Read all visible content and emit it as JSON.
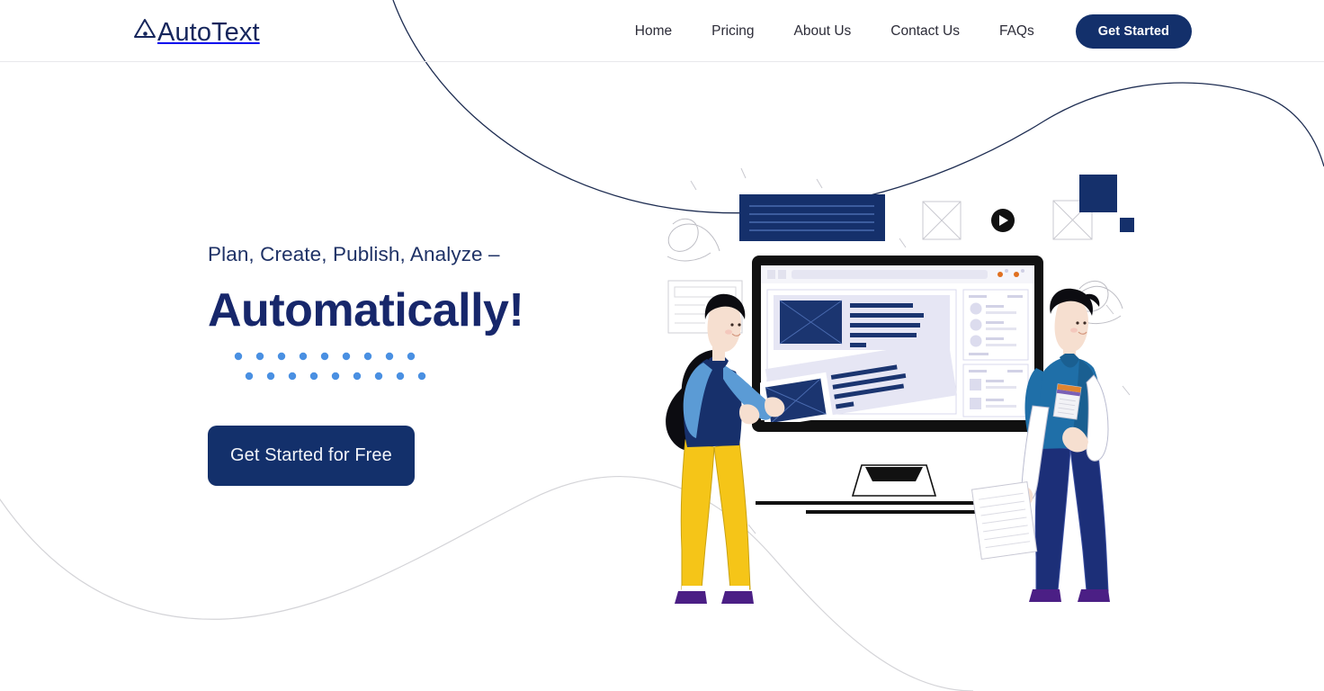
{
  "brand": {
    "name": "AutoText",
    "logo_icon": "triangle-a-logo-icon",
    "navy": "#13306b",
    "accent_blue": "#4a90e2",
    "yellow": "#f5c518",
    "teal": "#1f6fa8"
  },
  "header": {
    "nav_items": [
      {
        "label": "Home",
        "name": "nav-home"
      },
      {
        "label": "Pricing",
        "name": "nav-pricing"
      },
      {
        "label": "About Us",
        "name": "nav-about-us"
      },
      {
        "label": "Contact Us",
        "name": "nav-contact-us"
      },
      {
        "label": "FAQs",
        "name": "nav-faqs"
      }
    ],
    "cta_label": "Get Started"
  },
  "hero": {
    "eyebrow": "Plan, Create, Publish, Analyze –",
    "headline": "Automatically!",
    "cta_label": "Get Started for Free",
    "dot_rows": [
      9,
      9
    ],
    "dot_color": "#4a90e2"
  },
  "illustration": {
    "name": "content-marketing-team-illustration",
    "elements": [
      {
        "name": "navy-text-card",
        "type": "card"
      },
      {
        "name": "wireframe-card",
        "type": "card"
      },
      {
        "name": "wireframe-square-left",
        "type": "placeholder"
      },
      {
        "name": "wireframe-square-right",
        "type": "placeholder"
      },
      {
        "name": "play-button-badge",
        "type": "play"
      },
      {
        "name": "navy-square-large",
        "type": "square"
      },
      {
        "name": "navy-square-small",
        "type": "square"
      },
      {
        "name": "desktop-monitor",
        "type": "device"
      },
      {
        "name": "woman-character",
        "type": "person"
      },
      {
        "name": "man-character",
        "type": "person"
      },
      {
        "name": "squiggle-doodle-left",
        "type": "doodle"
      },
      {
        "name": "squiggle-doodle-right",
        "type": "doodle"
      }
    ]
  }
}
